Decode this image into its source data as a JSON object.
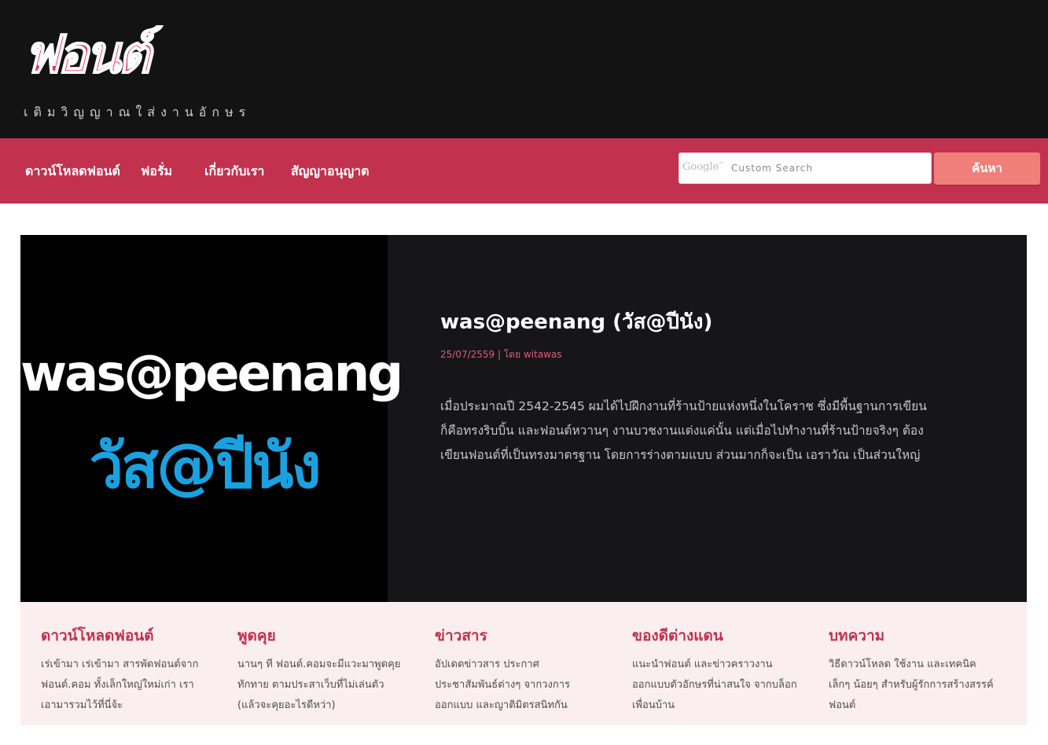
{
  "brand": {
    "logo_text": "ฟอนต์",
    "tagline": "เติมวิญญาณใส่งานอักษร",
    "accent_color": "#c2314e",
    "logo_color": "#ea2b65"
  },
  "nav": {
    "items": [
      {
        "label": "ดาวน์โหลดฟอนต์"
      },
      {
        "label": "ฟอรั่ม"
      },
      {
        "label": "เกี่ยวกับเรา"
      },
      {
        "label": "สัญญาอนุญาต"
      }
    ],
    "search": {
      "google_label": "Google",
      "placeholder": "Custom Search",
      "button_label": "ค้นหา"
    }
  },
  "feature": {
    "image_line1": "was@peenang",
    "image_line2": "วัส@ปีนัง",
    "title": "was@peenang (วัส@ปีนัง)",
    "date": "25/07/2559",
    "author_prefix": "โดย",
    "author": "witawas",
    "excerpt": "เมื่อประมาณปี 2542-2545 ผมได้ไปฝึกงานที่ร้านป้ายแห่งหนึ่งในโคราช ซึ่งมีพื้นฐานการเขียนก็คือทรงริบบิ้น และฟอนต์หวานๆ งานบวชงานแต่งแค่นั้น แต่เมื่อไปทำงานที่ร้านป้ายจริงๆ ต้องเขียนฟอนต์ที่เป็นทรงมาตรฐาน โดยการร่างตามแบบ ส่วนมากก็จะเป็น เอราวัณ เป็นส่วนใหญ่"
  },
  "columns": [
    {
      "title": "ดาวน์โหลดฟอนต์",
      "text": "เร่เข้ามา เร่เข้ามา สารพัดฟอนต์จาก ฟอนต์.คอม ทั้งเล็กใหญ่ใหม่เก่า เราเอามารวมไว้ที่นี่จ้ะ"
    },
    {
      "title": "พูดคุย",
      "text": "นานๆ ที ฟอนต์.คอมจะมีแวะมาพูดคุยทักทาย ตามประสาเว็บที่ไม่เล่นตัว (แล้วจะคุยอะไรดีหว่า)"
    },
    {
      "title": "ข่าวสาร",
      "text": "อัปเดตข่าวสาร ประกาศ ประชาสัมพันธ์ต่างๆ จากวงการออกแบบ และญาติมิตรสนิทกัน"
    },
    {
      "title": "ของดีต่างแดน",
      "text": "แนะนำฟอนต์ และข่าวคราวงานออกแบบตัวอักษรที่น่าสนใจ จากบล็อกเพื่อนบ้าน"
    },
    {
      "title": "บทความ",
      "text": "วิธีดาวน์โหลด ใช้งาน และเทคนิคเล็กๆ น้อยๆ สำหรับผู้รักการสร้างสรรค์ฟอนต์"
    }
  ]
}
